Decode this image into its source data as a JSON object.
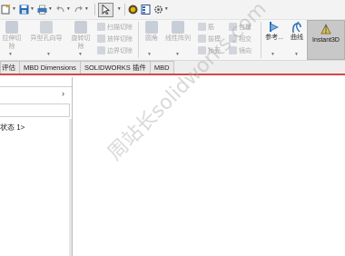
{
  "quick_access": {
    "icons": [
      "new-doc-icon",
      "save-icon",
      "print-icon",
      "undo-icon",
      "redo-icon",
      "select-pointer-icon",
      "rebuild-icon",
      "file-properties-icon",
      "options-gear-icon"
    ]
  },
  "ribbon": {
    "extrude_cut": "拉伸切\n除",
    "hole_wizard": "异型孔向导",
    "revolve_cut": "旋转切\n除",
    "sweep_cut": "扫描切除",
    "loft_cut": "放样切除",
    "boundary_cut": "边界切除",
    "fillet": "圆角",
    "linear_pattern": "线性阵列",
    "rib": "筋",
    "draft": "拔模",
    "shell": "抽壳",
    "wrap": "包覆",
    "intersect": "相交",
    "mirror": "镜向",
    "reference": "参考...",
    "curves": "曲线",
    "instant3d": "Instant3D"
  },
  "tabs": [
    "评估",
    "MBD Dimensions",
    "SOLIDWORKS 插件",
    "MBD"
  ],
  "panel": {
    "state_label": "状态 1>"
  },
  "watermark": "周站长solidworks.com",
  "colors": {
    "accent": "#d24848",
    "disabled_text": "#a9a9a9"
  }
}
